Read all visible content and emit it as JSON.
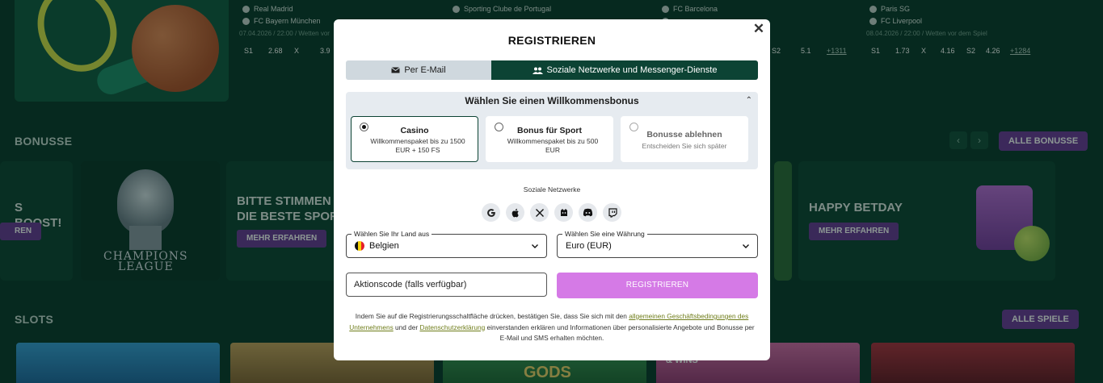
{
  "background": {
    "matches": [
      {
        "team1": "Real Madrid",
        "team2": "FC Bayern München",
        "date": "07.04.2026 / 22:00 / Wetten vor",
        "odds": [
          "S1",
          "2.68",
          "X",
          "3.9"
        ],
        "more": ""
      },
      {
        "team1": "Sporting Clube de Portugal",
        "team2": "",
        "date": "",
        "odds": [],
        "more": ""
      },
      {
        "team1": "FC Barcelona",
        "team2": "",
        "date": "",
        "odds": [
          "S2",
          "5.1"
        ],
        "more": "+1311"
      },
      {
        "team1": "Paris SG",
        "team2": "FC Liverpool",
        "date": "08.04.2026 / 22:00 / Wetten vor dem Spiel",
        "odds": [
          "S1",
          "1.73",
          "X",
          "4.16",
          "S2",
          "4.26"
        ],
        "more": "+1284"
      }
    ],
    "bonus_section_title": "BONUSSE",
    "all_bonuses_label": "ALLE BONUSSE",
    "nav_prev": "‹",
    "nav_next": "›",
    "bonus_cards": [
      {
        "title": "S BOOST!",
        "button": "REN"
      },
      {
        "title": "CHAMPIONS\nLEAGUE",
        "button": ""
      },
      {
        "title": "BITTE STIMMEN S\nDIE BESTE SPORT",
        "button": "MEHR ERFAHREN"
      },
      {
        "title": "HAPPY BETDAY",
        "button": "MEHR ERFAHREN"
      }
    ],
    "slots_section_title": "SLOTS",
    "all_games_label": "ALLE SPIELE",
    "slot_texts": [
      "GODS",
      "DROPS\n& WINS"
    ]
  },
  "modal": {
    "title": "REGISTRIEREN",
    "close_glyph": "✕",
    "tabs": [
      {
        "label": "Per E-Mail",
        "icon": "envelope-icon"
      },
      {
        "label": "Soziale Netzwerke und Messenger-Dienste",
        "icon": "users-icon"
      }
    ],
    "bonus": {
      "title": "Wählen Sie einen Willkommensbonus",
      "caret": "⌃",
      "options": [
        {
          "title": "Casino",
          "desc": "Willkommenspaket bis zu 1500 EUR + 150 FS",
          "selected": true
        },
        {
          "title": "Bonus für Sport",
          "desc": "Willkommenspaket bis zu 500 EUR",
          "selected": false
        },
        {
          "title": "Bonusse ablehnen",
          "desc": "Entscheiden Sie sich später",
          "selected": false
        }
      ]
    },
    "social_label": "Soziale Netzwerke",
    "social_icons": [
      "google-icon",
      "apple-icon",
      "x-icon",
      "mailru-icon",
      "discord-icon",
      "twitch-icon"
    ],
    "country": {
      "legend": "Wählen Sie Ihr Land aus",
      "value": "Belgien"
    },
    "currency": {
      "legend": "Wählen Sie eine Währung",
      "value": "Euro (EUR)"
    },
    "promo_placeholder": "Aktionscode (falls verfügbar)",
    "register_label": "REGISTRIEREN",
    "legal": {
      "part1": "Indem Sie auf die Registrierungsschaltfläche drücken, bestätigen Sie, dass Sie sich mit den ",
      "link1": "allgemeinen Geschäftsbedingungen des Unternehmens",
      "part2": " und der ",
      "link2": "Datenschutzerklärung",
      "part3": " einverstanden erklären und Informationen über personalisierte Angebote und Bonusse per E-Mail und SMS erhalten möchten."
    },
    "colors": {
      "accent_dark": "#0c4334",
      "register_button": "#d57ae6",
      "link": "#6f7d1a"
    }
  }
}
